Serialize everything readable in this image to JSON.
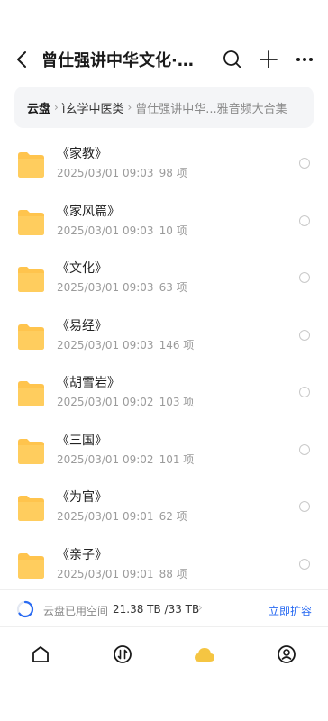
{
  "header": {
    "title": "曾仕强讲中华文化·...",
    "back_icon": "chevron-left-icon",
    "search_icon": "search-icon",
    "add_icon": "plus-icon",
    "more_icon": "more-horizontal-icon"
  },
  "breadcrumb": {
    "root": "云盘",
    "mid": "ì玄学中医类",
    "last": "曾仕强讲中华...雅音频大合集",
    "separator": "›"
  },
  "files": [
    {
      "name": "《家教》",
      "date": "2025/03/01 09:03",
      "count": "98 项"
    },
    {
      "name": "《家风篇》",
      "date": "2025/03/01 09:03",
      "count": "10 项"
    },
    {
      "name": "《文化》",
      "date": "2025/03/01 09:03",
      "count": "63 项"
    },
    {
      "name": "《易经》",
      "date": "2025/03/01 09:03",
      "count": "146 项"
    },
    {
      "name": "《胡雪岩》",
      "date": "2025/03/01 09:02",
      "count": "103 项"
    },
    {
      "name": "《三国》",
      "date": "2025/03/01 09:02",
      "count": "101 项"
    },
    {
      "name": "《为官》",
      "date": "2025/03/01 09:01",
      "count": "62 项"
    },
    {
      "name": "《亲子》",
      "date": "2025/03/01 09:01",
      "count": "88 项"
    }
  ],
  "storage": {
    "label": "云盘已用空间",
    "value": "21.38 TB /33 TB",
    "chevron": "›",
    "action": "立即扩容",
    "used_fraction": 0.648
  },
  "tabs": [
    {
      "icon": "home-icon"
    },
    {
      "icon": "transfer-icon"
    },
    {
      "icon": "cloud-icon",
      "active": true
    },
    {
      "icon": "profile-icon"
    }
  ],
  "colors": {
    "folder": "#ffc44d",
    "accent": "#2a6bf2",
    "active_tab": "#f5c542"
  }
}
